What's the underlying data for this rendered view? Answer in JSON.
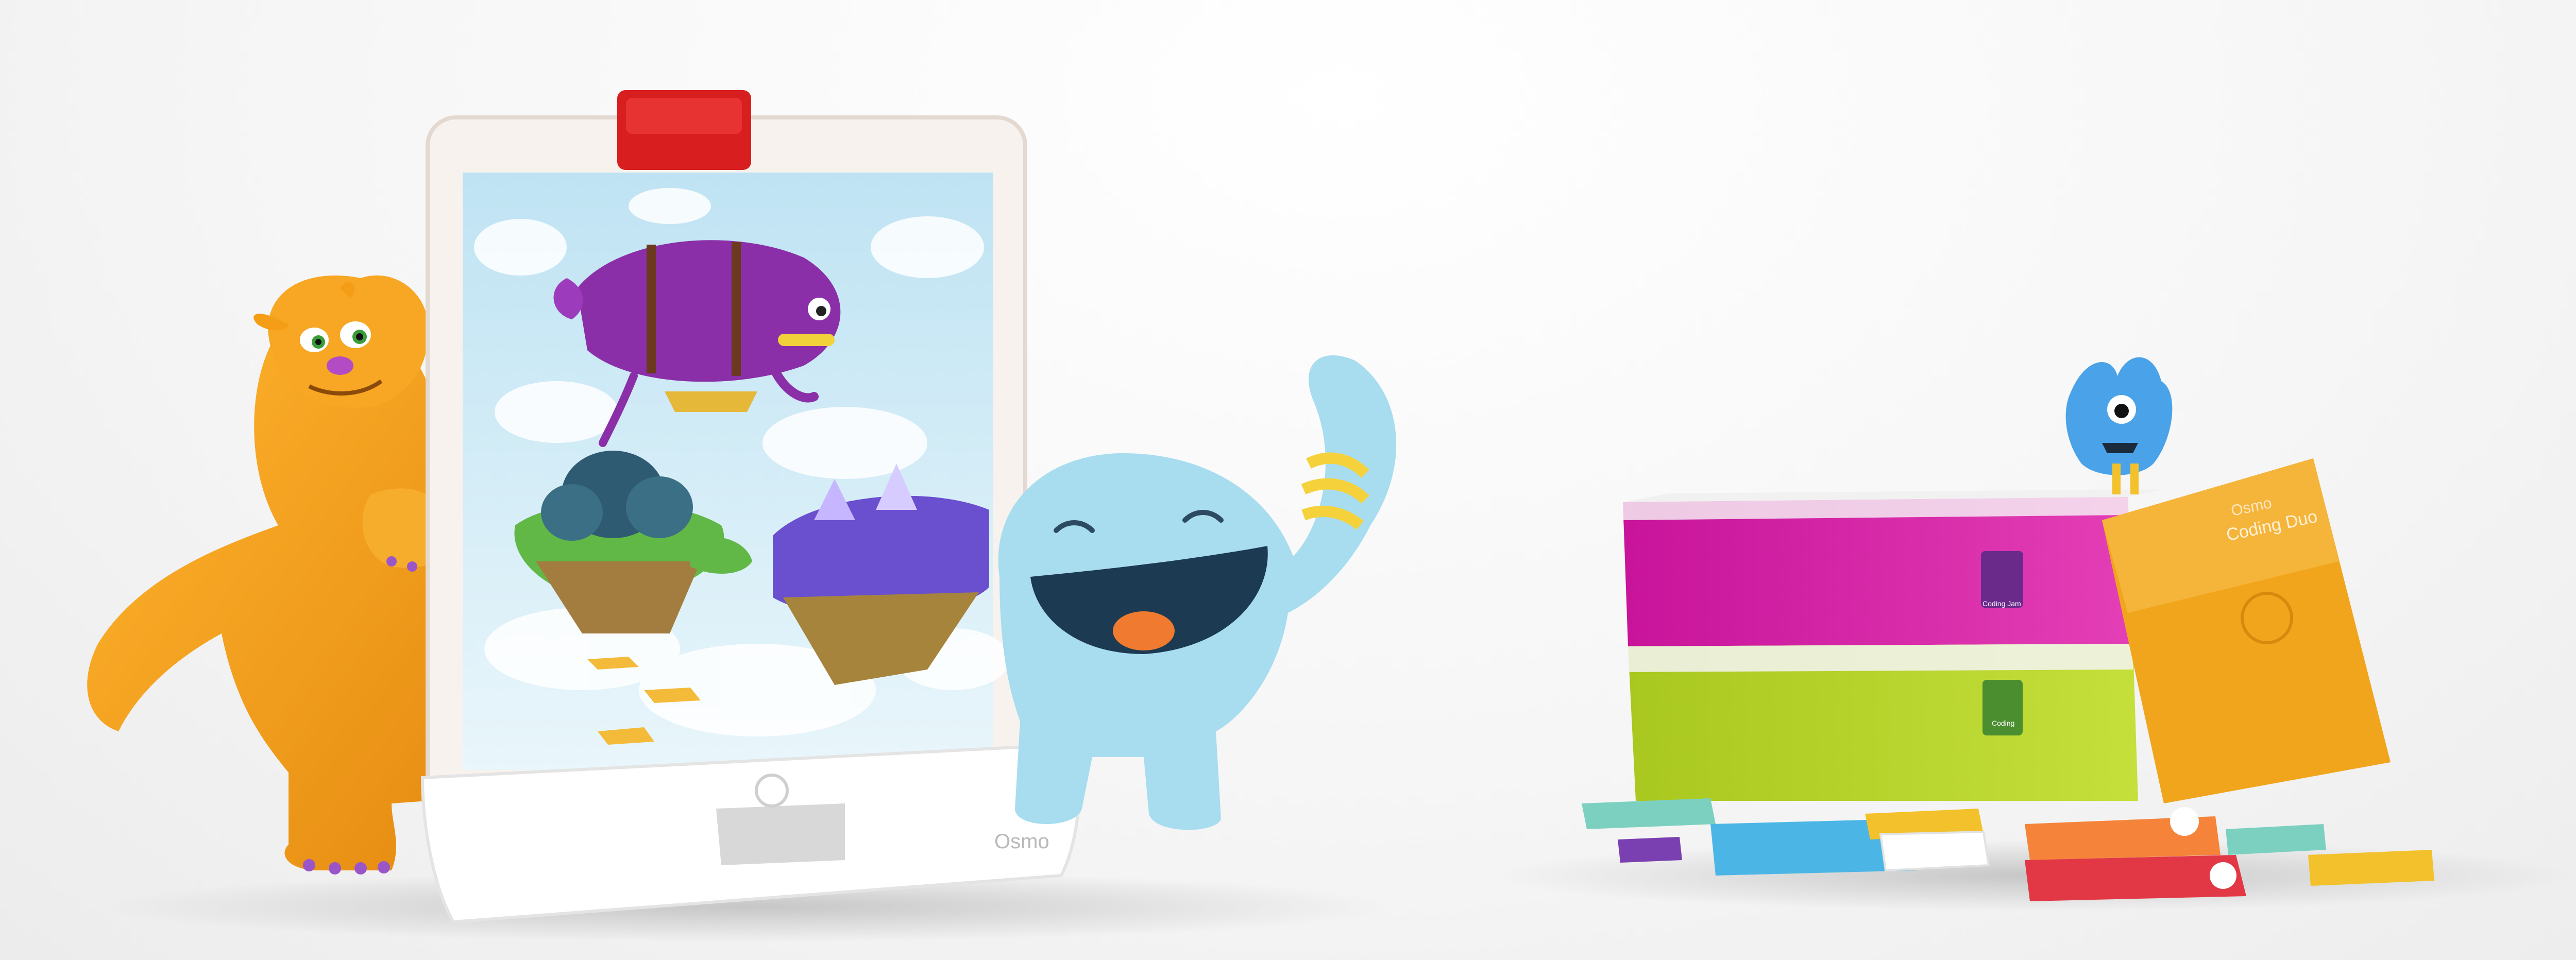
{
  "product": {
    "stand_brand_text": "Osmo",
    "box_brand_text": "Osmo",
    "box_title_text": "Coding Duo",
    "pink_tray_label": "Coding Jam",
    "green_tray_label": "Coding"
  },
  "colors": {
    "red_clip": "#d81e1e",
    "orange_monster": "#f5a21b",
    "purple_airship": "#8a2fa8",
    "blue_monster": "#a8dcef",
    "pink_tray": "#d0139f",
    "green_tray": "#b5d12a",
    "orange_box": "#f0a51c"
  }
}
